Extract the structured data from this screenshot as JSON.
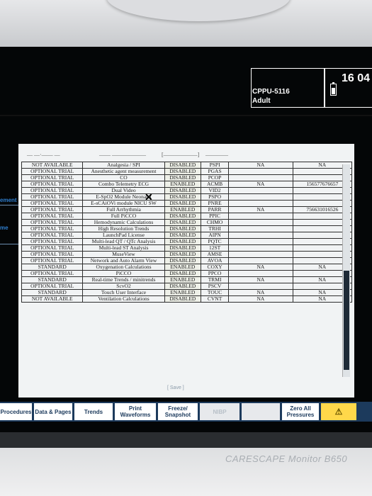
{
  "header": {
    "patient_id": "CPPU-5116",
    "patient_category": "Adult",
    "time": "16 04"
  },
  "side_labels": {
    "label_1": "ement",
    "label_2": "me"
  },
  "table": {
    "rows": [
      [
        "NOT AVAILABLE",
        "Analgesia / SPI",
        "DISABLED",
        "PSPI",
        "NA",
        "NA"
      ],
      [
        "OPTIONAL TRIAL",
        "Anesthetic agent measurement",
        "DISABLED",
        "PGAS",
        "",
        ""
      ],
      [
        "OPTIONAL TRIAL",
        "CO",
        "DISABLED",
        "PCOP",
        "",
        ""
      ],
      [
        "OPTIONAL TRIAL",
        "Combo Telemetry ECG",
        "ENABLED",
        "ACMB",
        "NA",
        "156577676657"
      ],
      [
        "OPTIONAL TRIAL",
        "Dual Video",
        "DISABLED",
        "VID2",
        "",
        ""
      ],
      [
        "OPTIONAL TRIAL",
        "E-SpO2 Module Neonatal",
        "DISABLED",
        "PSPO",
        "",
        ""
      ],
      [
        "OPTIONAL TRIAL",
        "E-sCAiOVi module NICU SW",
        "DISABLED",
        "PNRE",
        "",
        ""
      ],
      [
        "OPTIONAL TRIAL",
        "Full Arrhythmia",
        "ENABLED",
        "PARR",
        "NA",
        "756631016526"
      ],
      [
        "OPTIONAL TRIAL",
        "Full PiCCO",
        "DISABLED",
        "PPIC",
        "",
        ""
      ],
      [
        "OPTIONAL TRIAL",
        "Hemodynamic Calculations",
        "DISABLED",
        "CHMO",
        "",
        ""
      ],
      [
        "OPTIONAL TRIAL",
        "High Resolution Trends",
        "DISABLED",
        "TRHI",
        "",
        ""
      ],
      [
        "OPTIONAL TRIAL",
        "LaunchPad License",
        "DISABLED",
        "AIPN",
        "",
        ""
      ],
      [
        "OPTIONAL TRIAL",
        "Multi-lead QT / QTc Analysis",
        "DISABLED",
        "PQTC",
        "",
        ""
      ],
      [
        "OPTIONAL TRIAL",
        "Multi-lead ST Analysis",
        "DISABLED",
        "12ST",
        "",
        ""
      ],
      [
        "OPTIONAL TRIAL",
        "MuseView",
        "DISABLED",
        "AMSE",
        "",
        ""
      ],
      [
        "OPTIONAL TRIAL",
        "Network and Auto Alarm View",
        "DISABLED",
        "AVOA",
        "",
        ""
      ],
      [
        "STANDARD",
        "Oxygenation Calculations",
        "ENABLED",
        "COXY",
        "NA",
        "NA"
      ],
      [
        "OPTIONAL TRIAL",
        "PiCCO",
        "DISABLED",
        "PPCO",
        "",
        ""
      ],
      [
        "STANDARD",
        "Real-time Trends / minitrends",
        "ENABLED",
        "TRMI",
        "NA",
        "NA"
      ],
      [
        "OPTIONAL TRIAL",
        "ScvO2",
        "DISABLED",
        "PSCV",
        "",
        ""
      ],
      [
        "STANDARD",
        "Touch User Interface",
        "ENABLED",
        "TOUC",
        "NA",
        "NA"
      ],
      [
        "NOT AVAILABLE",
        "Ventilation Calculations",
        "DISABLED",
        "CVNT",
        "NA",
        "NA"
      ]
    ]
  },
  "save_label": "[ Save ]",
  "menu": {
    "procedures": "Procedures",
    "data_pages": "Data & Pages",
    "trends": "Trends",
    "print_waveforms": "Print Waveforms",
    "freeze_snapshot": "Freeze/ Snapshot",
    "nibp": "NIBP",
    "zero_all_pressures": "Zero All Pressures",
    "alarm_symbol": "⚠"
  },
  "device_brand": "CARESCAPE Monitor B650",
  "colors": {
    "screen": "#040607",
    "menubar": "#1c3a5c",
    "accent_blue": "#2f7fd0",
    "alarm": "#ffd84a"
  }
}
